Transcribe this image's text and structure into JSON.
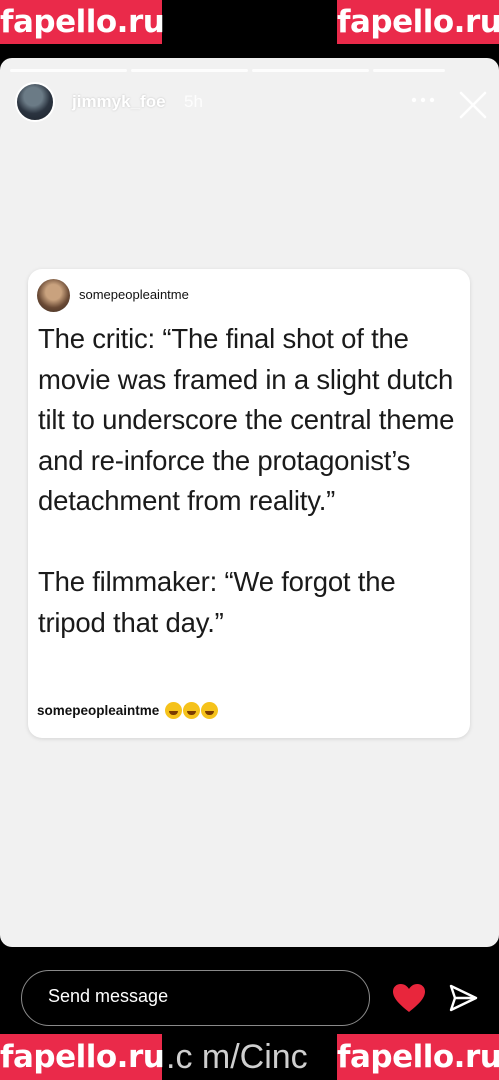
{
  "watermarks": {
    "top_left": "fapello.ru",
    "top_right": "fapello.ru",
    "bottom_left": "fapello.ru",
    "bottom_right": "fapello.ru"
  },
  "story": {
    "progress_segments": 4,
    "username": "jimmyk_foe",
    "time": "5h",
    "more_icon": "more-horizontal-icon",
    "close_icon": "close-icon"
  },
  "post": {
    "handle": "somepeopleaintme",
    "lines_1": "The critic: “The final shot of the movie was framed in a slight dutch tilt to underscore the central theme and re-inforce the protagonist’s detachment from reality.”",
    "lines_2": "The filmmaker: “We forgot the tripod that day.”",
    "caption_handle": "somepeopleaintme",
    "caption_emojis": "😂😂😂"
  },
  "footer": {
    "send_placeholder": "Send message",
    "heart_color": "#e8263c",
    "partial_link": ".c m/Cinc"
  }
}
